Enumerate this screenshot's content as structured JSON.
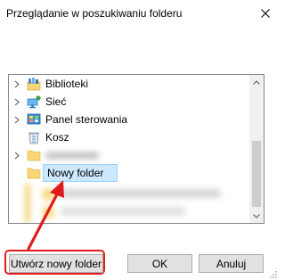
{
  "dialog": {
    "title": "Przeglądanie w poszukiwaniu folderu"
  },
  "tree": {
    "items": [
      {
        "label": "Biblioteki",
        "icon": "libraries-icon",
        "expandable": true
      },
      {
        "label": "Sieć",
        "icon": "network-icon",
        "expandable": true
      },
      {
        "label": "Panel sterowania",
        "icon": "control-panel-icon",
        "expandable": true
      },
      {
        "label": "Kosz",
        "icon": "recycle-bin-icon",
        "expandable": false
      },
      {
        "label": "",
        "icon": "folder-icon",
        "expandable": true,
        "blurred": true
      },
      {
        "label": "Nowy folder",
        "icon": "folder-icon",
        "expandable": false,
        "selected": true
      }
    ]
  },
  "buttons": {
    "new_folder": "Utwórz nowy folder",
    "ok": "OK",
    "cancel": "Anuluj"
  },
  "colors": {
    "selection_bg": "#cce8ff",
    "selection_border": "#99d1ff",
    "annotation": "#e21b1b",
    "folder_yellow": "#f8d775"
  }
}
